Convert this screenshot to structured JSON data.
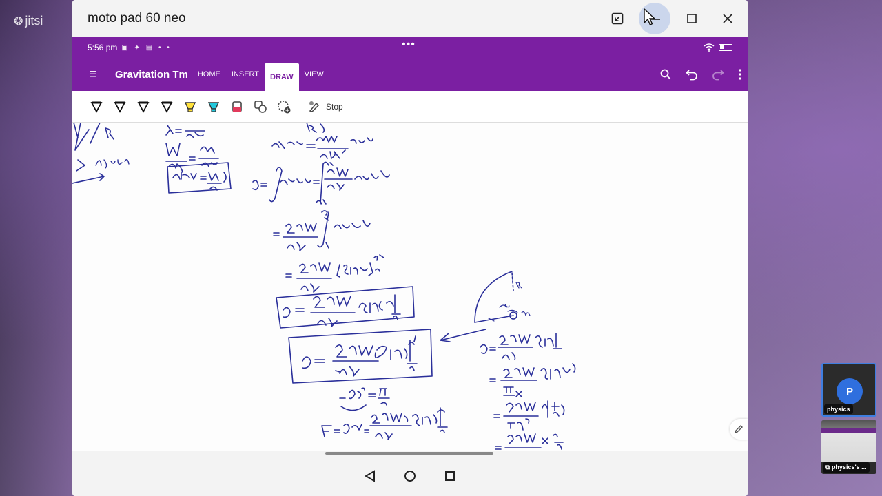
{
  "brand": {
    "name": "jitsi"
  },
  "window": {
    "title": "moto pad 60 neo"
  },
  "tablet": {
    "status": {
      "time": "5:56 pm"
    },
    "app": {
      "notebook": "Gravitation Tm",
      "tabs": [
        {
          "label": "HOME"
        },
        {
          "label": "INSERT"
        },
        {
          "label": "DRAW"
        },
        {
          "label": "VIEW"
        }
      ],
      "active_tab": "DRAW",
      "stop_label": "Stop"
    }
  },
  "participants": [
    {
      "initial": "P",
      "name": "physics"
    },
    {
      "name": "physics's ..."
    }
  ],
  "colors": {
    "onenote_purple": "#7b1fa2",
    "ink": "#2a2f9a",
    "avatar": "#2f6fde",
    "active_border": "#3f7ee0"
  }
}
